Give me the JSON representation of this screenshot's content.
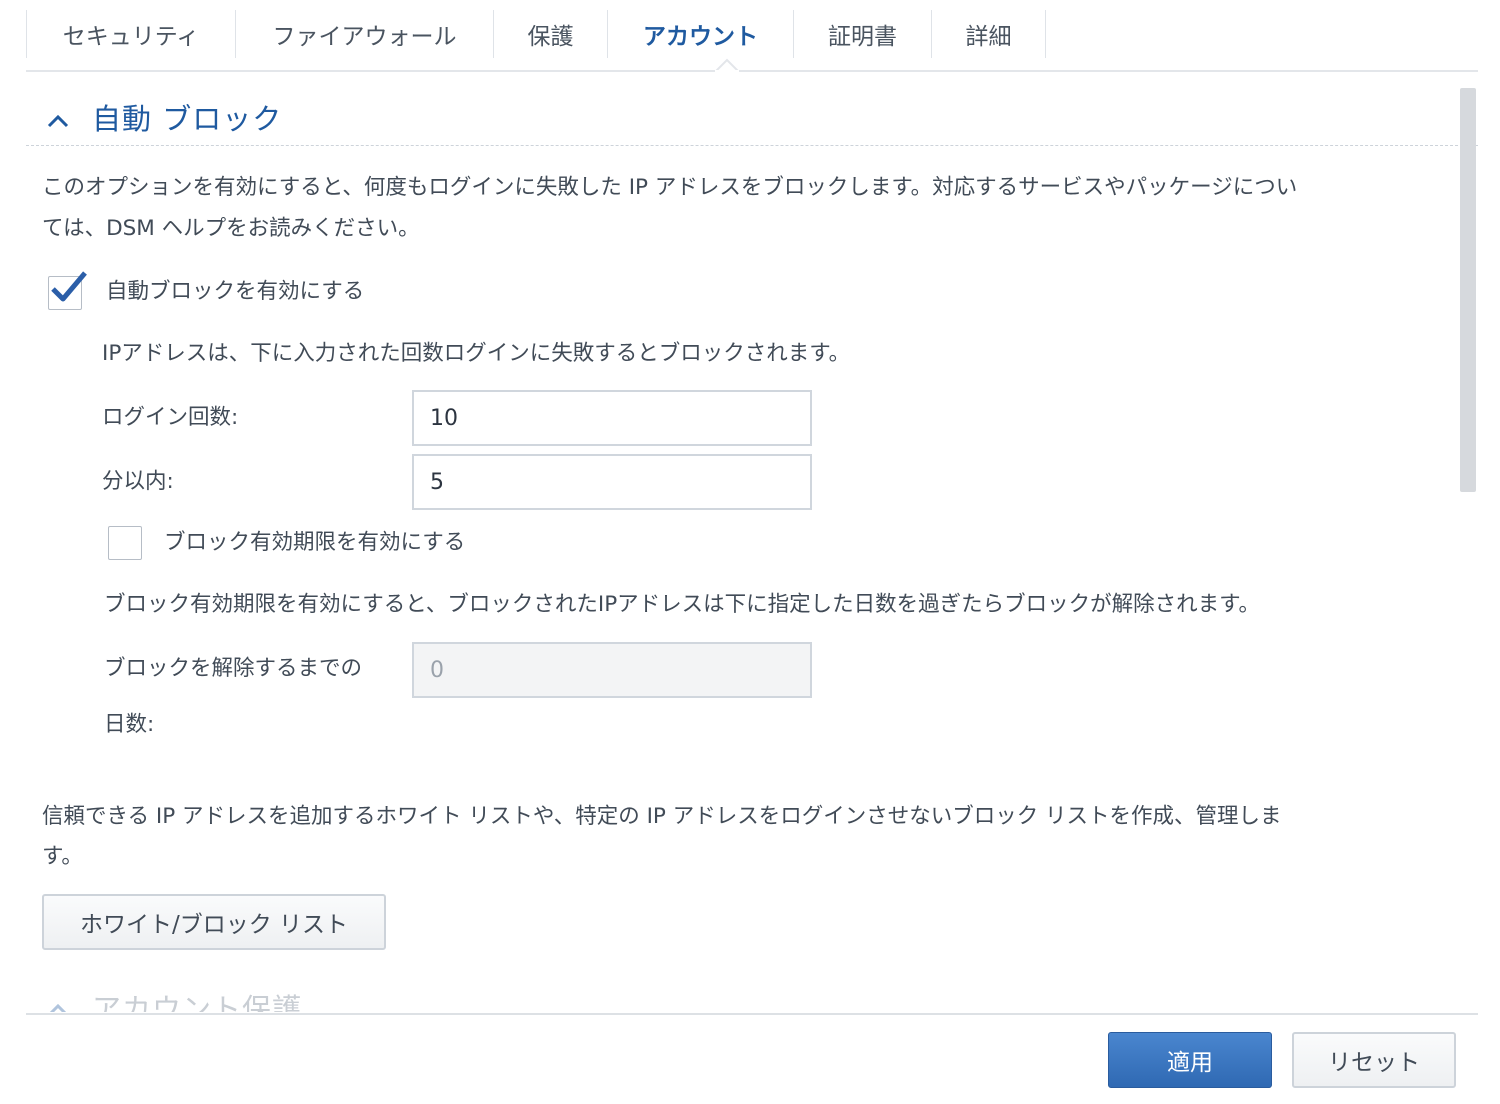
{
  "tabs": [
    {
      "label": "セキュリティ",
      "active": false
    },
    {
      "label": "ファイアウォール",
      "active": false
    },
    {
      "label": "保護",
      "active": false
    },
    {
      "label": "アカウント",
      "active": true
    },
    {
      "label": "証明書",
      "active": false
    },
    {
      "label": "詳細",
      "active": false
    }
  ],
  "section": {
    "title": "自動 ブロック",
    "description_line1": "このオプションを有効にすると、何度もログインに失敗した IP アドレスをブロックします。対応するサービスやパッケージについ",
    "description_line2": "ては、DSM ヘルプをお読みください。",
    "enable_auto_block": {
      "label": "自動ブロックを有効にする",
      "checked": true
    },
    "block_rule_text": "IPアドレスは、下に入力された回数ログインに失敗するとブロックされます。",
    "login_attempts": {
      "label": "ログイン回数:",
      "value": "10"
    },
    "within_minutes": {
      "label": "分以内:",
      "value": "5"
    },
    "enable_expiration": {
      "label": "ブロック有効期限を有効にする",
      "checked": false
    },
    "expiration_text": "ブロック有効期限を有効にすると、ブロックされたIPアドレスは下に指定した日数を過ぎたらブロックが解除されます。",
    "unblock_days": {
      "label_line1": "ブロックを解除するまでの",
      "label_line2": "日数:",
      "value": "0",
      "disabled": true
    },
    "list_text_line1": "信頼できる IP アドレスを追加するホワイト リストや、特定の IP アドレスをログインさせないブロック リストを作成、管理しま",
    "list_text_line2": "す。",
    "list_button": "ホワイト/ブロック リスト"
  },
  "next_section_title": "アカウント保護",
  "footer": {
    "apply": "適用",
    "reset": "リセット"
  },
  "colors": {
    "accent": "#1f5aa0",
    "primary_button": "#3a75c0"
  },
  "icons": {
    "section_toggle": "chevron-up-icon",
    "check": "checkmark-icon"
  }
}
